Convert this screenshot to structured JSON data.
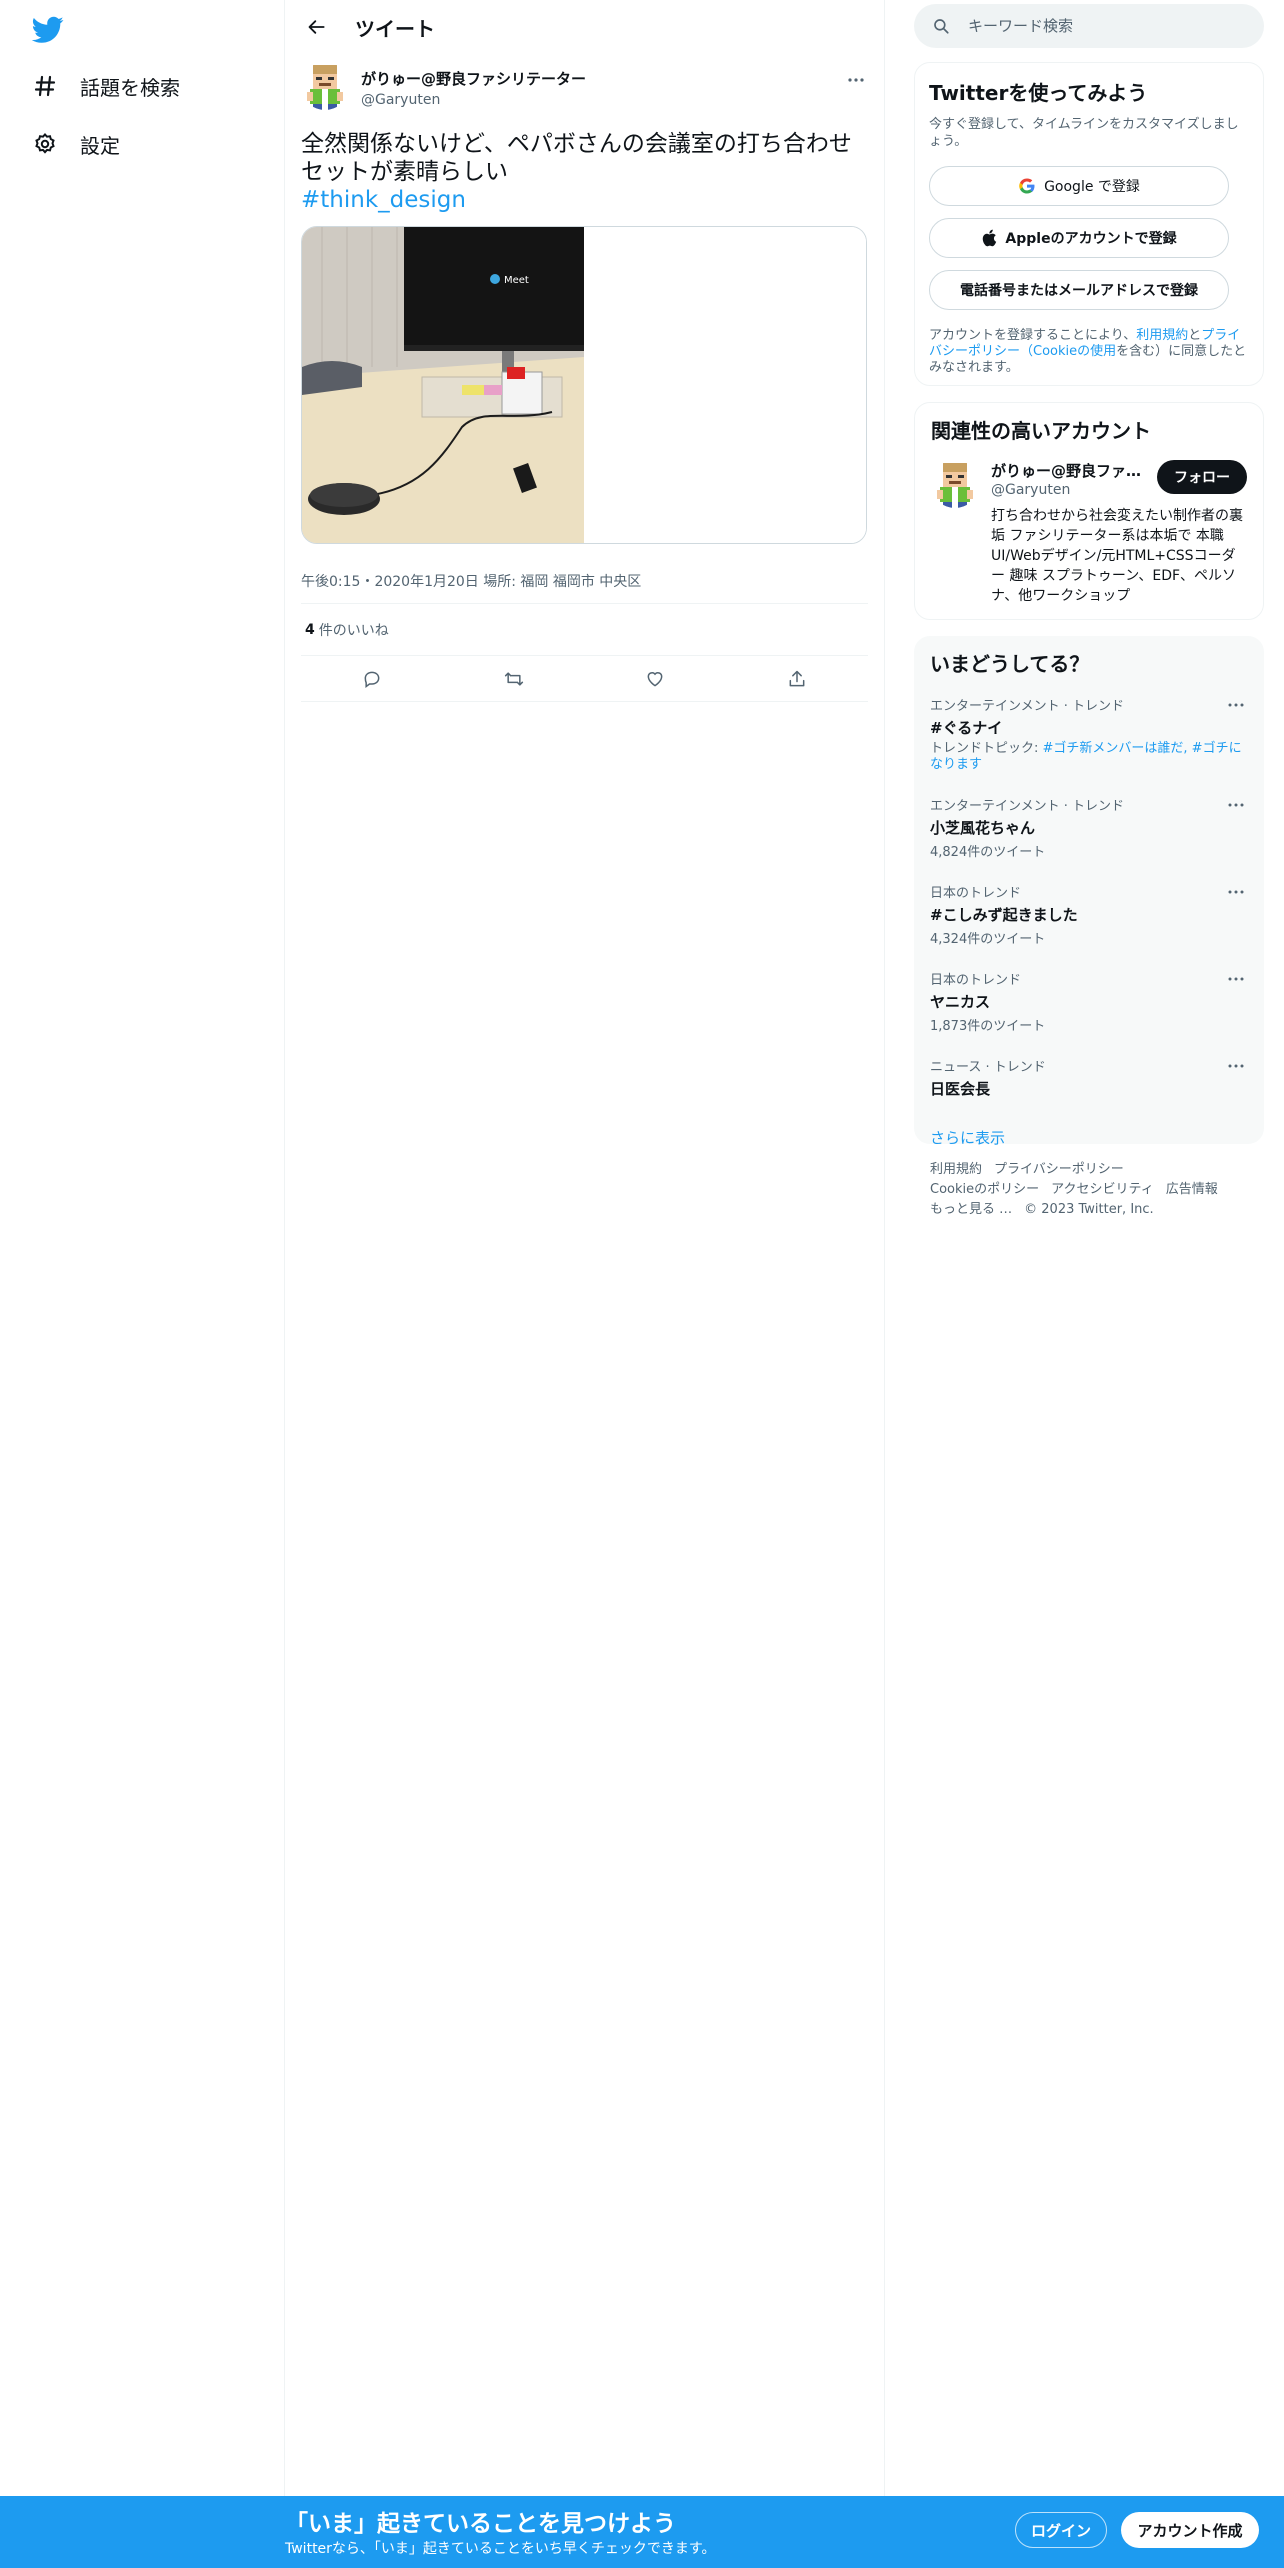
{
  "nav": {
    "logo_icon": "twitter-bird-icon",
    "items": [
      {
        "label": "話題を検索",
        "icon": "hashtag-icon"
      },
      {
        "label": "設定",
        "icon": "gear-icon"
      }
    ]
  },
  "main": {
    "title": "ツイート",
    "tweet": {
      "display_name": "がりゅー@野良ファシリテーター",
      "handle": "@Garyuten",
      "text": "全然関係ないけど、ペパボさんの会議室の打ち合わせセットが素晴らしい",
      "hashtag": "#think_design",
      "meta": "午後0:15・2020年1月20日 場所: 福岡 福岡市 中央区",
      "like_count": "4",
      "like_label": "件のいいね",
      "media_monitor_text": "Meet"
    }
  },
  "sidebar": {
    "search_placeholder": "キーワード検索",
    "signup": {
      "title": "Twitterを使ってみよう",
      "subtitle": "今すぐ登録して、タイムラインをカスタマイズしましょう。",
      "google": "Google で登録",
      "apple": "Appleのアカウントで登録",
      "phone": "電話番号またはメールアドレスで登録",
      "terms_pre": "アカウントを登録することにより、",
      "terms_link1": "利用規約",
      "terms_mid1": "と",
      "terms_link2": "プライバシーポリシー（Cookieの使用",
      "terms_post": "を含む）に同意したとみなされます。"
    },
    "relevant": {
      "title": "関連性の高いアカウント",
      "name": "がりゅー@野良ファシリテーター",
      "handle": "@Garyuten",
      "follow": "フォロー",
      "bio": "打ち合わせから社会変えたい制作者の裏垢 ファシリテーター系は本垢で 本職 UI/Webデザイン/元HTML+CSSコーダー 趣味 スプラトゥーン、EDF、ペルソナ、他ワークショップ"
    },
    "trends": {
      "title": "いまどうしてる？",
      "items": [
        {
          "category": "エンターテインメント · トレンド",
          "name": "#ぐるナイ",
          "topic_label": "トレンドトピック: ",
          "topic": "#ゴチ新メンバーは誰だ, #ゴチになります"
        },
        {
          "category": "エンターテインメント · トレンド",
          "name": "小芝風花ちゃん",
          "count": "4,824件のツイート"
        },
        {
          "category": "日本のトレンド",
          "name": "#こしみず起きました",
          "count": "4,324件のツイート"
        },
        {
          "category": "日本のトレンド",
          "name": "ヤニカス",
          "count": "1,873件のツイート"
        },
        {
          "category": "ニュース · トレンド",
          "name": "日医会長"
        }
      ],
      "show_more": "さらに表示"
    },
    "footer": {
      "terms": "利用規約",
      "privacy": "プライバシーポリシー",
      "cookie": "Cookieのポリシー",
      "accessibility": "アクセシビリティ",
      "ads": "広告情報",
      "more": "もっと見る …",
      "copyright": "© 2023 Twitter, Inc."
    }
  },
  "banner": {
    "title": "「いま」起きていることを見つけよう",
    "subtitle": "Twitterなら、「いま」起きていることをいち早くチェックできます。",
    "login": "ログイン",
    "signup": "アカウント作成"
  },
  "colors": {
    "accent": "#1d9bf0",
    "text": "#0f1419",
    "secondary": "#536471",
    "border": "#eff3f4"
  }
}
